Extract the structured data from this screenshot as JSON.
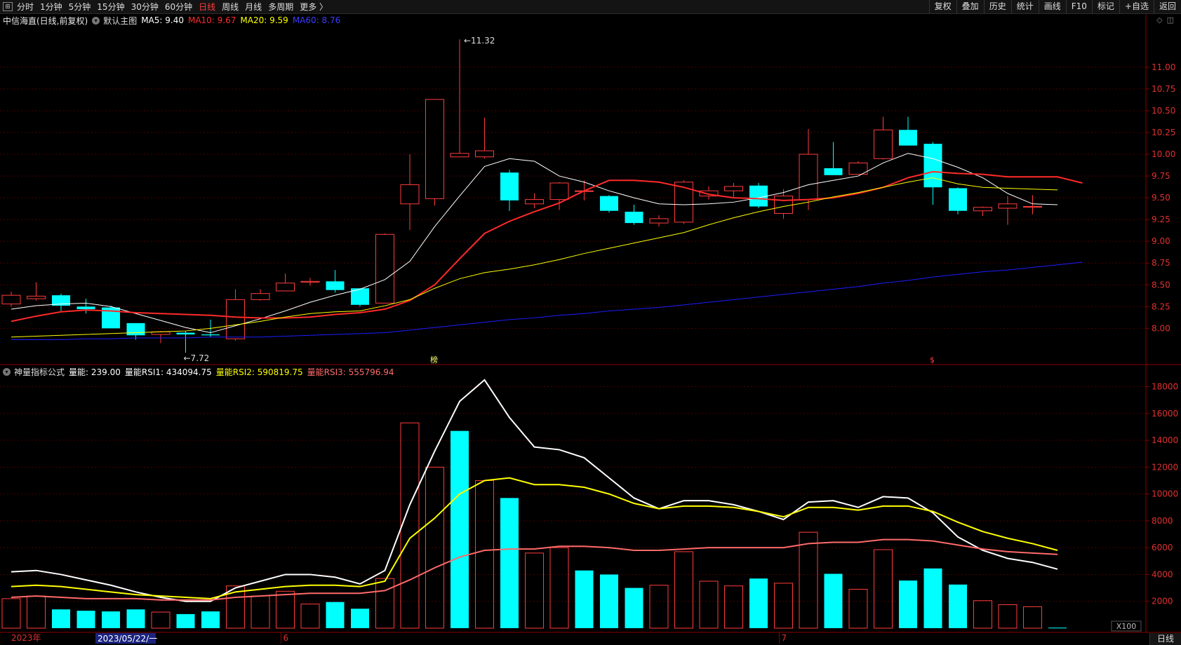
{
  "toolbar": {
    "timeframes": [
      "分时",
      "1分钟",
      "5分钟",
      "15分钟",
      "30分钟",
      "60分钟",
      "日线",
      "周线",
      "月线",
      "多周期",
      "更多 〉"
    ],
    "active_timeframe": "日线",
    "right_buttons": [
      "复权",
      "叠加",
      "历史",
      "统计",
      "画线",
      "F10",
      "标记",
      "+自选",
      "返回"
    ]
  },
  "main_panel": {
    "stock_title": "中信海直(日线,前复权)",
    "template_label": "默认主图",
    "ma": [
      {
        "label": "MA5: 9.40",
        "color": "#ffffff"
      },
      {
        "label": "MA10: 9.67",
        "color": "#ff2a2a"
      },
      {
        "label": "MA20: 9.59",
        "color": "#ffff00"
      },
      {
        "label": "MA60: 8.76",
        "color": "#3c3cff"
      }
    ],
    "high_label": "11.32",
    "low_label": "7.72",
    "marker_a": "榜",
    "marker_b": "$"
  },
  "sub_panel": {
    "indicator_name": "神量指标公式",
    "items": [
      {
        "label": "量能: 239.00",
        "color": "#ffffff"
      },
      {
        "label": "量能RSI1: 434094.75",
        "color": "#ffffff"
      },
      {
        "label": "量能RSI2: 590819.75",
        "color": "#ffff00"
      },
      {
        "label": "量能RSI3: 555796.94",
        "color": "#ff6a6a"
      }
    ],
    "unit_label": "X100"
  },
  "x_axis": {
    "year_label": "2023年",
    "cursor_date": "2023/05/22/一",
    "month_labels": [
      {
        "label": "6",
        "index": 11
      },
      {
        "label": "7",
        "index": 31
      }
    ]
  },
  "period_label": "日线",
  "colors": {
    "up": "#ff3c3c",
    "down": "#00ffff",
    "grid": "#4a0000",
    "axis": "#8b0000",
    "tick_text": "#e03030"
  },
  "chart_data": [
    {
      "type": "candlestick",
      "title": "中信海直(日线,前复权)",
      "ylim": [
        7.6,
        11.45
      ],
      "yticks": [
        8.0,
        8.25,
        8.5,
        8.75,
        9.0,
        9.25,
        9.5,
        9.75,
        10.0,
        10.25,
        10.5,
        10.75,
        11.0
      ],
      "candles": [
        {
          "o": 8.28,
          "h": 8.42,
          "l": 8.25,
          "c": 8.38
        },
        {
          "o": 8.34,
          "h": 8.53,
          "l": 8.32,
          "c": 8.37
        },
        {
          "o": 8.38,
          "h": 8.4,
          "l": 8.2,
          "c": 8.26
        },
        {
          "o": 8.25,
          "h": 8.34,
          "l": 8.17,
          "c": 8.22
        },
        {
          "o": 8.24,
          "h": 8.26,
          "l": 8.0,
          "c": 8.0
        },
        {
          "o": 8.06,
          "h": 8.06,
          "l": 7.87,
          "c": 7.92
        },
        {
          "o": 7.93,
          "h": 7.97,
          "l": 7.83,
          "c": 7.96
        },
        {
          "o": 7.95,
          "h": 7.97,
          "l": 7.72,
          "c": 7.93
        },
        {
          "o": 7.93,
          "h": 8.1,
          "l": 7.9,
          "c": 7.92
        },
        {
          "o": 7.88,
          "h": 8.45,
          "l": 7.86,
          "c": 8.33
        },
        {
          "o": 8.33,
          "h": 8.45,
          "l": 8.32,
          "c": 8.4
        },
        {
          "o": 8.43,
          "h": 8.63,
          "l": 8.43,
          "c": 8.52
        },
        {
          "o": 8.53,
          "h": 8.58,
          "l": 8.49,
          "c": 8.54
        },
        {
          "o": 8.54,
          "h": 8.67,
          "l": 8.41,
          "c": 8.44
        },
        {
          "o": 8.46,
          "h": 8.46,
          "l": 8.25,
          "c": 8.27
        },
        {
          "o": 8.29,
          "h": 9.09,
          "l": 8.29,
          "c": 9.08
        },
        {
          "o": 9.43,
          "h": 10.0,
          "l": 9.13,
          "c": 9.65
        },
        {
          "o": 9.49,
          "h": 10.63,
          "l": 9.41,
          "c": 10.63
        },
        {
          "o": 9.97,
          "h": 11.32,
          "l": 10.01,
          "c": 10.01
        },
        {
          "o": 9.97,
          "h": 10.42,
          "l": 9.95,
          "c": 10.04
        },
        {
          "o": 9.79,
          "h": 9.82,
          "l": 9.35,
          "c": 9.47
        },
        {
          "o": 9.43,
          "h": 9.55,
          "l": 9.38,
          "c": 9.48
        },
        {
          "o": 9.48,
          "h": 9.68,
          "l": 9.36,
          "c": 9.67
        },
        {
          "o": 9.58,
          "h": 9.7,
          "l": 9.47,
          "c": 9.58
        },
        {
          "o": 9.52,
          "h": 9.53,
          "l": 9.33,
          "c": 9.35
        },
        {
          "o": 9.34,
          "h": 9.42,
          "l": 9.19,
          "c": 9.21
        },
        {
          "o": 9.21,
          "h": 9.3,
          "l": 9.17,
          "c": 9.26
        },
        {
          "o": 9.22,
          "h": 9.7,
          "l": 9.2,
          "c": 9.68
        },
        {
          "o": 9.52,
          "h": 9.63,
          "l": 9.48,
          "c": 9.58
        },
        {
          "o": 9.58,
          "h": 9.67,
          "l": 9.51,
          "c": 9.63
        },
        {
          "o": 9.64,
          "h": 9.67,
          "l": 9.38,
          "c": 9.4
        },
        {
          "o": 9.32,
          "h": 9.6,
          "l": 9.26,
          "c": 9.52
        },
        {
          "o": 9.48,
          "h": 10.29,
          "l": 9.36,
          "c": 10.0
        },
        {
          "o": 9.84,
          "h": 10.14,
          "l": 9.78,
          "c": 9.76
        },
        {
          "o": 9.77,
          "h": 9.92,
          "l": 9.77,
          "c": 9.9
        },
        {
          "o": 9.95,
          "h": 10.43,
          "l": 9.94,
          "c": 10.28
        },
        {
          "o": 10.28,
          "h": 10.43,
          "l": 10.1,
          "c": 10.1
        },
        {
          "o": 10.12,
          "h": 10.14,
          "l": 9.42,
          "c": 9.62
        },
        {
          "o": 9.61,
          "h": 9.62,
          "l": 9.31,
          "c": 9.35
        },
        {
          "o": 9.35,
          "h": 9.4,
          "l": 9.29,
          "c": 9.39
        },
        {
          "o": 9.38,
          "h": 9.52,
          "l": 9.19,
          "c": 9.43
        },
        {
          "o": 9.4,
          "h": 9.53,
          "l": 9.31,
          "c": 9.4
        }
      ],
      "series": [
        {
          "name": "MA5",
          "color": "#ffffff",
          "values": [
            8.22,
            8.26,
            8.28,
            8.29,
            8.25,
            8.17,
            8.09,
            8.01,
            7.95,
            8.03,
            8.11,
            8.2,
            8.3,
            8.38,
            8.45,
            8.56,
            8.77,
            9.17,
            9.52,
            9.86,
            9.95,
            9.92,
            9.75,
            9.68,
            9.58,
            9.5,
            9.43,
            9.42,
            9.43,
            9.45,
            9.5,
            9.56,
            9.65,
            9.7,
            9.75,
            9.9,
            10.01,
            9.95,
            9.85,
            9.73,
            9.55,
            9.43,
            9.42
          ]
        },
        {
          "name": "MA10",
          "color": "#ff2a2a",
          "values": [
            8.08,
            8.14,
            8.19,
            8.21,
            8.2,
            8.18,
            8.17,
            8.16,
            8.15,
            8.13,
            8.12,
            8.12,
            8.13,
            8.16,
            8.18,
            8.22,
            8.32,
            8.5,
            8.8,
            9.09,
            9.23,
            9.34,
            9.44,
            9.58,
            9.7,
            9.7,
            9.68,
            9.62,
            9.54,
            9.5,
            9.49,
            9.47,
            9.48,
            9.5,
            9.55,
            9.62,
            9.73,
            9.8,
            9.78,
            9.77,
            9.74,
            9.74,
            9.74,
            9.67
          ]
        },
        {
          "name": "MA20",
          "color": "#ffff00",
          "values": [
            7.9,
            7.91,
            7.92,
            7.93,
            7.94,
            7.95,
            7.96,
            7.97,
            8.0,
            8.04,
            8.08,
            8.13,
            8.17,
            8.19,
            8.2,
            8.26,
            8.33,
            8.46,
            8.57,
            8.64,
            8.68,
            8.73,
            8.79,
            8.86,
            8.92,
            8.98,
            9.04,
            9.1,
            9.19,
            9.27,
            9.34,
            9.4,
            9.45,
            9.51,
            9.56,
            9.62,
            9.68,
            9.73,
            9.66,
            9.62,
            9.61,
            9.6,
            9.59
          ]
        },
        {
          "name": "MA60",
          "color": "#1c1cff",
          "values": [
            7.87,
            7.87,
            7.87,
            7.88,
            7.88,
            7.89,
            7.89,
            7.89,
            7.9,
            7.9,
            7.9,
            7.91,
            7.92,
            7.93,
            7.94,
            7.95,
            7.98,
            8.01,
            8.04,
            8.07,
            8.1,
            8.12,
            8.15,
            8.17,
            8.2,
            8.22,
            8.24,
            8.27,
            8.3,
            8.33,
            8.36,
            8.39,
            8.42,
            8.45,
            8.48,
            8.52,
            8.55,
            8.59,
            8.62,
            8.65,
            8.67,
            8.7,
            8.73,
            8.76
          ]
        }
      ]
    },
    {
      "type": "bar",
      "title": "神量指标公式",
      "ylim": [
        0,
        18600
      ],
      "yticks": [
        2000,
        4000,
        6000,
        8000,
        10000,
        12000,
        14000,
        16000,
        18000
      ],
      "bars": [
        {
          "v": 2200,
          "up": true
        },
        {
          "v": 2400,
          "up": true
        },
        {
          "v": 1400,
          "up": false
        },
        {
          "v": 1300,
          "up": false
        },
        {
          "v": 1250,
          "up": false
        },
        {
          "v": 1400,
          "up": false
        },
        {
          "v": 1200,
          "up": true
        },
        {
          "v": 1050,
          "up": false
        },
        {
          "v": 1250,
          "up": false
        },
        {
          "v": 3150,
          "up": true
        },
        {
          "v": 2400,
          "up": true
        },
        {
          "v": 2750,
          "up": true
        },
        {
          "v": 1800,
          "up": true
        },
        {
          "v": 1950,
          "up": false
        },
        {
          "v": 1450,
          "up": false
        },
        {
          "v": 3700,
          "up": true
        },
        {
          "v": 15300,
          "up": true
        },
        {
          "v": 12000,
          "up": true
        },
        {
          "v": 14700,
          "up": false
        },
        {
          "v": 11000,
          "up": true
        },
        {
          "v": 9700,
          "up": false
        },
        {
          "v": 5600,
          "up": true
        },
        {
          "v": 6000,
          "up": true
        },
        {
          "v": 4300,
          "up": false
        },
        {
          "v": 4000,
          "up": false
        },
        {
          "v": 3000,
          "up": false
        },
        {
          "v": 3200,
          "up": true
        },
        {
          "v": 5700,
          "up": true
        },
        {
          "v": 3500,
          "up": true
        },
        {
          "v": 3150,
          "up": true
        },
        {
          "v": 3700,
          "up": false
        },
        {
          "v": 3350,
          "up": true
        },
        {
          "v": 7150,
          "up": true
        },
        {
          "v": 4050,
          "up": false
        },
        {
          "v": 2900,
          "up": true
        },
        {
          "v": 5850,
          "up": true
        },
        {
          "v": 3550,
          "up": false
        },
        {
          "v": 4450,
          "up": false
        },
        {
          "v": 3250,
          "up": false
        },
        {
          "v": 2050,
          "up": true
        },
        {
          "v": 1750,
          "up": true
        },
        {
          "v": 1600,
          "up": true
        },
        {
          "v": 40,
          "up": false
        }
      ],
      "series": [
        {
          "name": "量能RSI1",
          "color": "#ffffff",
          "values": [
            4200,
            4300,
            4000,
            3600,
            3200,
            2700,
            2300,
            2000,
            2000,
            3000,
            3500,
            4000,
            4000,
            3800,
            3300,
            4300,
            9200,
            13200,
            16900,
            18500,
            15700,
            13500,
            13300,
            12700,
            11200,
            9700,
            8900,
            9500,
            9500,
            9200,
            8700,
            8100,
            9400,
            9500,
            9000,
            9800,
            9700,
            8600,
            6800,
            5800,
            5200,
            4900,
            4400
          ]
        },
        {
          "name": "量能RSI2",
          "color": "#ffff00",
          "values": [
            3100,
            3200,
            3100,
            2900,
            2700,
            2500,
            2400,
            2300,
            2200,
            2700,
            2900,
            3100,
            3200,
            3200,
            3100,
            3500,
            6700,
            8200,
            10000,
            11000,
            11200,
            10700,
            10700,
            10500,
            10000,
            9300,
            8900,
            9100,
            9100,
            9000,
            8700,
            8300,
            9000,
            9000,
            8800,
            9100,
            9100,
            8700,
            7900,
            7200,
            6700,
            6300,
            5800
          ]
        },
        {
          "name": "量能RSI3",
          "color": "#ff6a6a",
          "values": [
            2300,
            2400,
            2300,
            2200,
            2200,
            2200,
            2100,
            2100,
            2100,
            2300,
            2400,
            2500,
            2600,
            2600,
            2600,
            2800,
            3600,
            4500,
            5300,
            5800,
            5900,
            5900,
            6100,
            6100,
            6000,
            5800,
            5800,
            5900,
            6000,
            6000,
            6000,
            6000,
            6300,
            6400,
            6400,
            6600,
            6600,
            6500,
            6200,
            5900,
            5700,
            5600,
            5500
          ]
        }
      ]
    }
  ]
}
